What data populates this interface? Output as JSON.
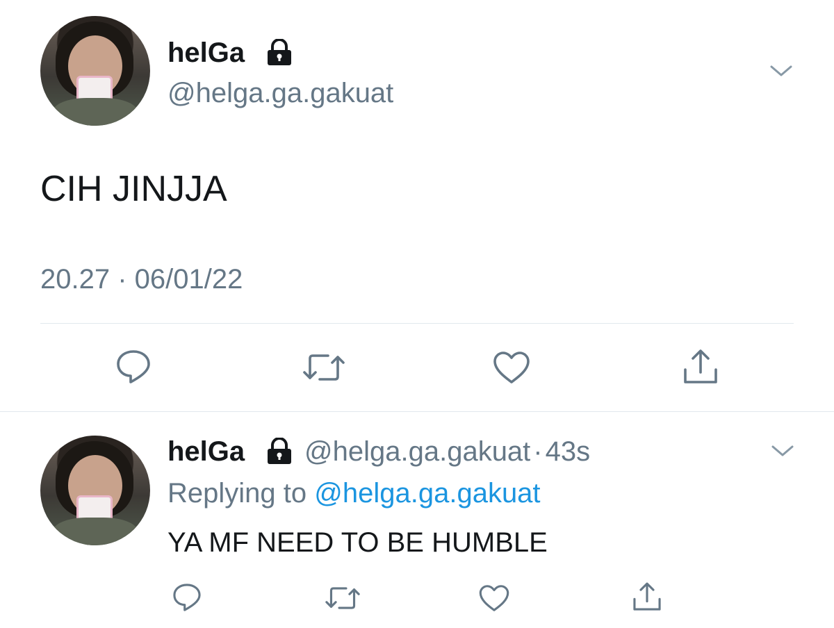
{
  "main_tweet": {
    "display_name": "helGa",
    "handle": "@helga.ga.gakuat",
    "text": "CIH JINJJA",
    "timestamp": "20.27 · 06/01/22",
    "icons": {
      "lock": "lock-icon",
      "menu": "chevron-down-icon"
    },
    "actions": [
      "reply-icon",
      "retweet-icon",
      "like-icon",
      "share-icon"
    ]
  },
  "reply_tweet": {
    "display_name": "helGa",
    "handle": "@helga.ga.gakuat",
    "separator": "·",
    "time_ago": "43s",
    "replying_prefix": "Replying to",
    "replying_handle": "@helga.ga.gakuat",
    "text": "YA MF NEED TO BE HUMBLE",
    "actions": [
      "reply-icon",
      "retweet-icon",
      "like-icon",
      "share-icon"
    ]
  },
  "colors": {
    "text": "#14171a",
    "muted": "#657786",
    "link": "#1b95e0",
    "divider": "#e1e8ed",
    "icon": "#657786"
  }
}
